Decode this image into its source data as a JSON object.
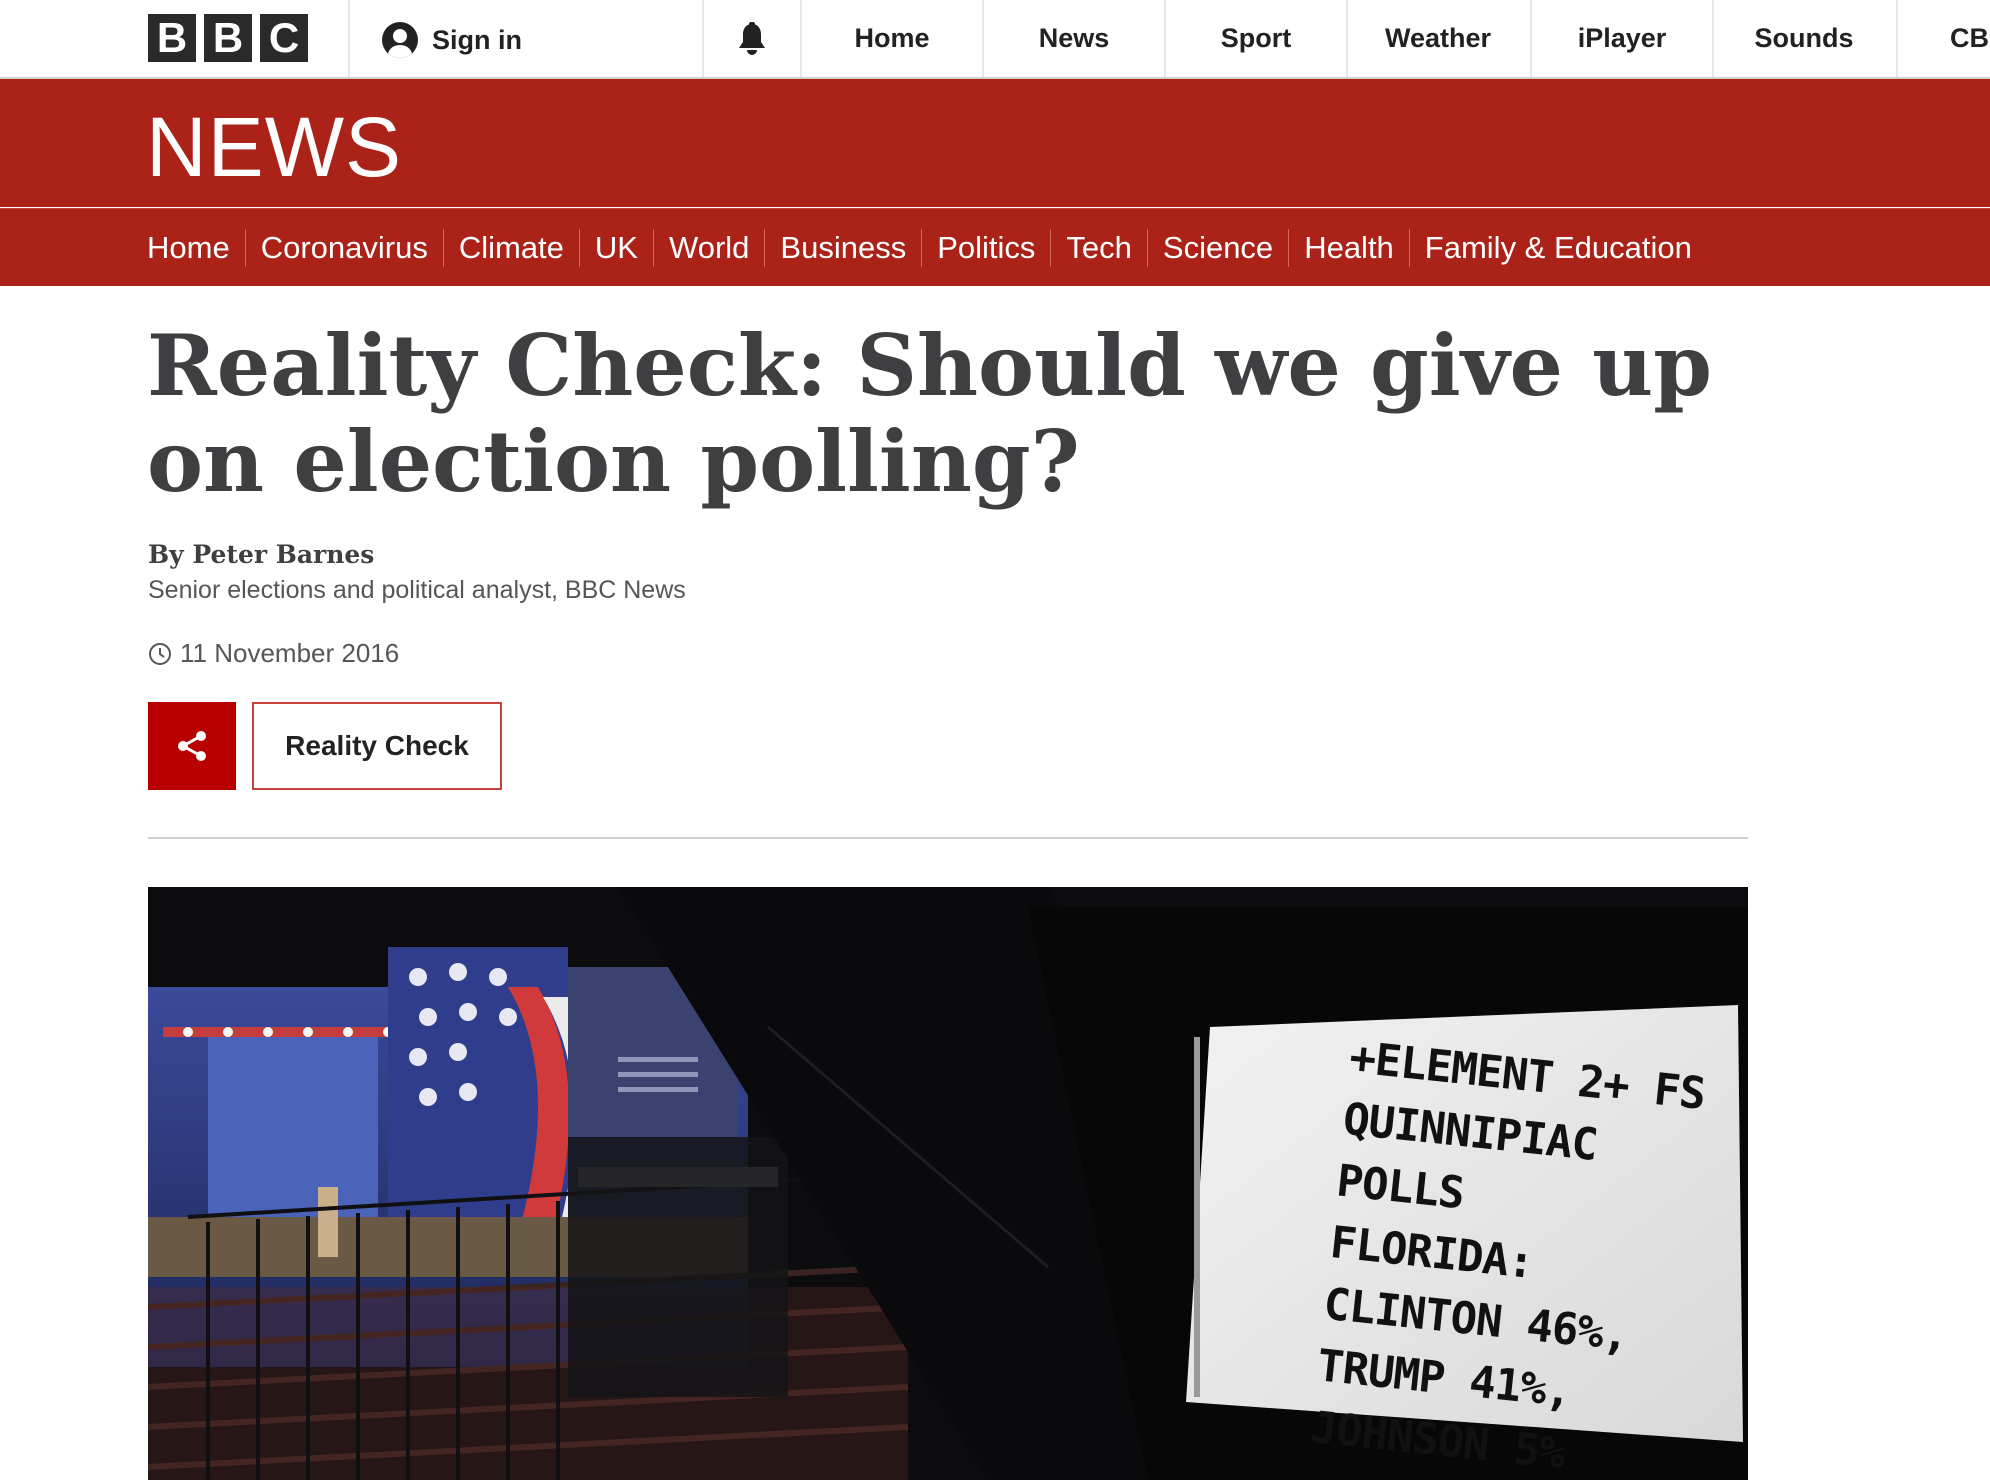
{
  "global_nav": {
    "logo": [
      "B",
      "B",
      "C"
    ],
    "sign_in": "Sign in",
    "items": [
      "Home",
      "News",
      "Sport",
      "Weather",
      "iPlayer",
      "Sounds",
      "CB"
    ]
  },
  "news_band": {
    "wordmark": "NEWS"
  },
  "section_nav": [
    "Home",
    "Coronavirus",
    "Climate",
    "UK",
    "World",
    "Business",
    "Politics",
    "Tech",
    "Science",
    "Health",
    "Family & Education"
  ],
  "article": {
    "headline": "Reality Check: Should we give up on election polling?",
    "byline": "By Peter Barnes",
    "role": "Senior elections and political analyst, BBC News",
    "date": "11 November 2016",
    "tag": "Reality Check"
  },
  "photo": {
    "monitor_lines": [
      "+ELEMENT 2+ FS",
      "QUINNIPIAC",
      "POLLS",
      "FLORIDA:",
      "CLINTON 46%,",
      "TRUMP 41%,",
      "JOHNSON 5%"
    ]
  },
  "colors": {
    "bbc_red": "#aa2218",
    "share_red": "#b80000",
    "text_dark": "#3f3f42"
  }
}
